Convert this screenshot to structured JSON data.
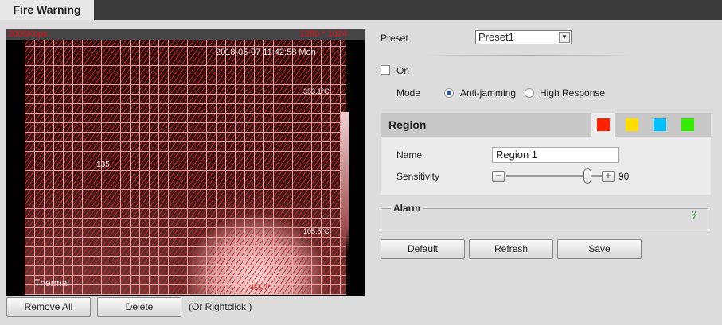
{
  "tab": {
    "title": "Fire Warning"
  },
  "video": {
    "bitrate": "2006Kbps",
    "resolution": "1280 * 1024",
    "timestamp": "2018-05-07 11:42:58 Mon",
    "channel": "Thermal",
    "temp_max": "353.1°C",
    "temp_mid": "135",
    "temp_right": "105.5°C",
    "temp_bottom": "455.7°"
  },
  "video_buttons": {
    "remove_all": "Remove All",
    "delete": "Delete",
    "hint": "(Or Rightclick )"
  },
  "preset": {
    "label": "Preset",
    "value": "Preset1"
  },
  "enable": {
    "label": "On",
    "checked": false
  },
  "mode": {
    "label": "Mode",
    "options": [
      "Anti-jamming",
      "High Response"
    ],
    "selected": "Anti-jamming"
  },
  "region": {
    "title": "Region",
    "colors": [
      "#ff2200",
      "#ffdd00",
      "#00c0ff",
      "#33ee00"
    ],
    "selected_color": "#ff2200",
    "name_label": "Name",
    "name_value": "Region 1",
    "sensitivity_label": "Sensitivity",
    "sensitivity": "90"
  },
  "alarm": {
    "label": "Alarm"
  },
  "buttons": {
    "default": "Default",
    "refresh": "Refresh",
    "save": "Save"
  }
}
